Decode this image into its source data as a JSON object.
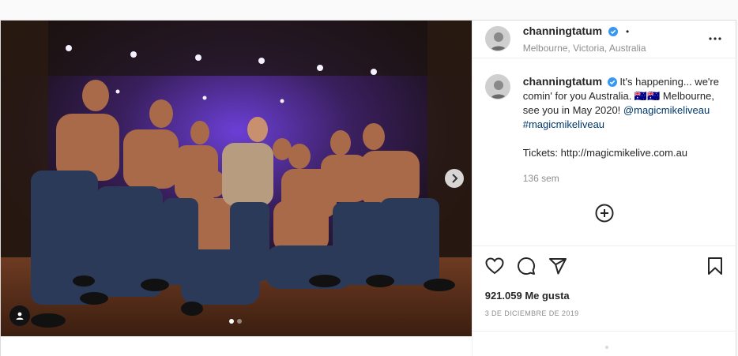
{
  "post": {
    "username": "channingtatum",
    "location": "Melbourne, Victoria, Australia",
    "bullet": "•",
    "caption": {
      "part1": "It's happening... we're comin' for you Australia. 🇦🇺🇦🇺 Melbourne, see you in May 2020! ",
      "mention": "@magicmikeliveau",
      "hashtag": "#magicmikeliveau",
      "tickets": "Tickets: http://magicmikelive.com.au",
      "time": "136 sem"
    },
    "likes": "921.059 Me gusta",
    "date": "3 DE DICIEMBRE DE 2019"
  },
  "carousel": {
    "current": 1,
    "total": 2
  },
  "colors": {
    "verified": "#3897f0",
    "link": "#00376b",
    "stage_light": "#8a4dff"
  },
  "icons": [
    "verified-icon",
    "more-options-icon",
    "add-comment-icon",
    "heart-icon",
    "comment-icon",
    "share-icon",
    "bookmark-icon",
    "tag-user-icon",
    "next-arrow-icon"
  ]
}
